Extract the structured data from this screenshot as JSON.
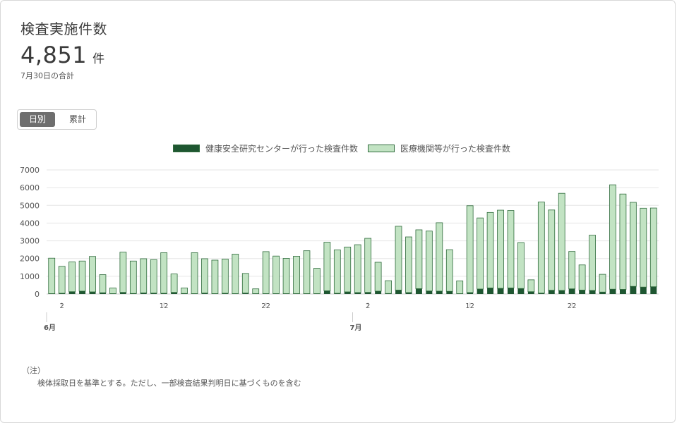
{
  "card": {
    "title": "検査実施件数",
    "total_value": "4,851",
    "total_unit": "件",
    "total_caption": "7月30日の合計"
  },
  "toggle": {
    "daily_label": "日別",
    "cumulative_label": "累計",
    "selected": "日別"
  },
  "notes": {
    "heading": "（注）",
    "line1": "検体採取日を基準とする。ただし、一部検査結果判明日に基づくものを含む"
  },
  "colors": {
    "center": "#1e5631",
    "medical": "#c2e3c3",
    "bar_outline": "#2f6b3c",
    "grid": "#e6e6e6"
  },
  "chart_data": {
    "type": "bar",
    "stacked": true,
    "categories": [
      "6/1",
      "6/2",
      "6/3",
      "6/4",
      "6/5",
      "6/6",
      "6/7",
      "6/8",
      "6/9",
      "6/10",
      "6/11",
      "6/12",
      "6/13",
      "6/14",
      "6/15",
      "6/16",
      "6/17",
      "6/18",
      "6/19",
      "6/20",
      "6/21",
      "6/22",
      "6/23",
      "6/24",
      "6/25",
      "6/26",
      "6/27",
      "6/28",
      "6/29",
      "6/30",
      "7/1",
      "7/2",
      "7/3",
      "7/4",
      "7/5",
      "7/6",
      "7/7",
      "7/8",
      "7/9",
      "7/10",
      "7/11",
      "7/12",
      "7/13",
      "7/14",
      "7/15",
      "7/16",
      "7/17",
      "7/18",
      "7/19",
      "7/20",
      "7/21",
      "7/22",
      "7/23",
      "7/24",
      "7/25",
      "7/26",
      "7/27",
      "7/28",
      "7/29",
      "7/30"
    ],
    "series": [
      {
        "name": "健康安全研究センターが行った検査件数",
        "color": "#1e5631",
        "values": [
          20,
          40,
          130,
          160,
          120,
          70,
          20,
          90,
          30,
          60,
          50,
          40,
          90,
          30,
          20,
          50,
          20,
          40,
          20,
          50,
          20,
          20,
          20,
          20,
          20,
          20,
          20,
          180,
          40,
          120,
          80,
          90,
          160,
          30,
          220,
          80,
          300,
          170,
          160,
          150,
          20,
          80,
          280,
          340,
          320,
          340,
          310,
          130,
          50,
          210,
          200,
          290,
          220,
          200,
          110,
          270,
          260,
          430,
          390,
          410
        ]
      },
      {
        "name": "医療機関等が行った検査件数",
        "color": "#c2e3c3",
        "values": [
          2000,
          1520,
          1680,
          1700,
          2000,
          1020,
          320,
          2270,
          1830,
          1930,
          1890,
          2290,
          1040,
          310,
          2310,
          1940,
          1890,
          1930,
          2230,
          1110,
          270,
          2370,
          2120,
          1990,
          2110,
          2420,
          1430,
          2740,
          2450,
          2530,
          2700,
          3050,
          1630,
          720,
          3600,
          3140,
          3320,
          3380,
          3860,
          2350,
          720,
          4900,
          4010,
          4260,
          4410,
          4370,
          2590,
          670,
          5140,
          4530,
          5480,
          2110,
          1420,
          3120,
          1000,
          5890,
          5380,
          4740,
          4450,
          4440
        ]
      }
    ],
    "y_ticks": [
      0,
      1000,
      2000,
      3000,
      4000,
      5000,
      6000,
      7000
    ],
    "ylim": [
      0,
      7000
    ],
    "x_tick_labels": [
      {
        "index": 1,
        "label": "2"
      },
      {
        "index": 11,
        "label": "12"
      },
      {
        "index": 21,
        "label": "22"
      },
      {
        "index": 31,
        "label": "2"
      },
      {
        "index": 41,
        "label": "12"
      },
      {
        "index": 51,
        "label": "22"
      }
    ],
    "month_labels": [
      {
        "index": 0,
        "label": "6月"
      },
      {
        "index": 30,
        "label": "7月"
      }
    ],
    "grid": true,
    "legend_position": "top-center"
  }
}
